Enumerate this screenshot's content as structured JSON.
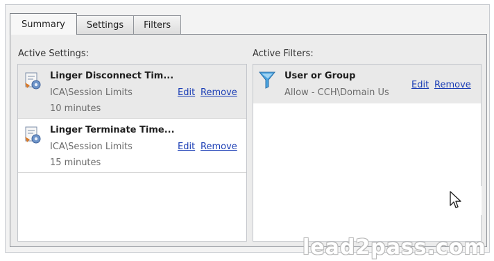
{
  "tabs": [
    {
      "label": "Summary",
      "active": true
    },
    {
      "label": "Settings",
      "active": false
    },
    {
      "label": "Filters",
      "active": false
    }
  ],
  "active_settings": {
    "title": "Active Settings:",
    "items": [
      {
        "name": "Linger Disconnect Tim...",
        "path": "ICA\\Session Limits",
        "value": "10 minutes",
        "edit": "Edit",
        "remove": "Remove",
        "icon": "policy-setting-icon"
      },
      {
        "name": "Linger Terminate Time...",
        "path": "ICA\\Session Limits",
        "value": "15 minutes",
        "edit": "Edit",
        "remove": "Remove",
        "icon": "policy-setting-icon"
      }
    ]
  },
  "active_filters": {
    "title": "Active Filters:",
    "items": [
      {
        "name": "User or Group",
        "detail": "Allow - CCH\\Domain Us",
        "edit": "Edit",
        "remove": "Remove",
        "icon": "funnel-filter-icon"
      }
    ]
  },
  "watermark": "lead2pass.com",
  "colors": {
    "link": "#1a3db5",
    "selected_row": "#e9e9e9",
    "panel_bg": "#ececec"
  }
}
